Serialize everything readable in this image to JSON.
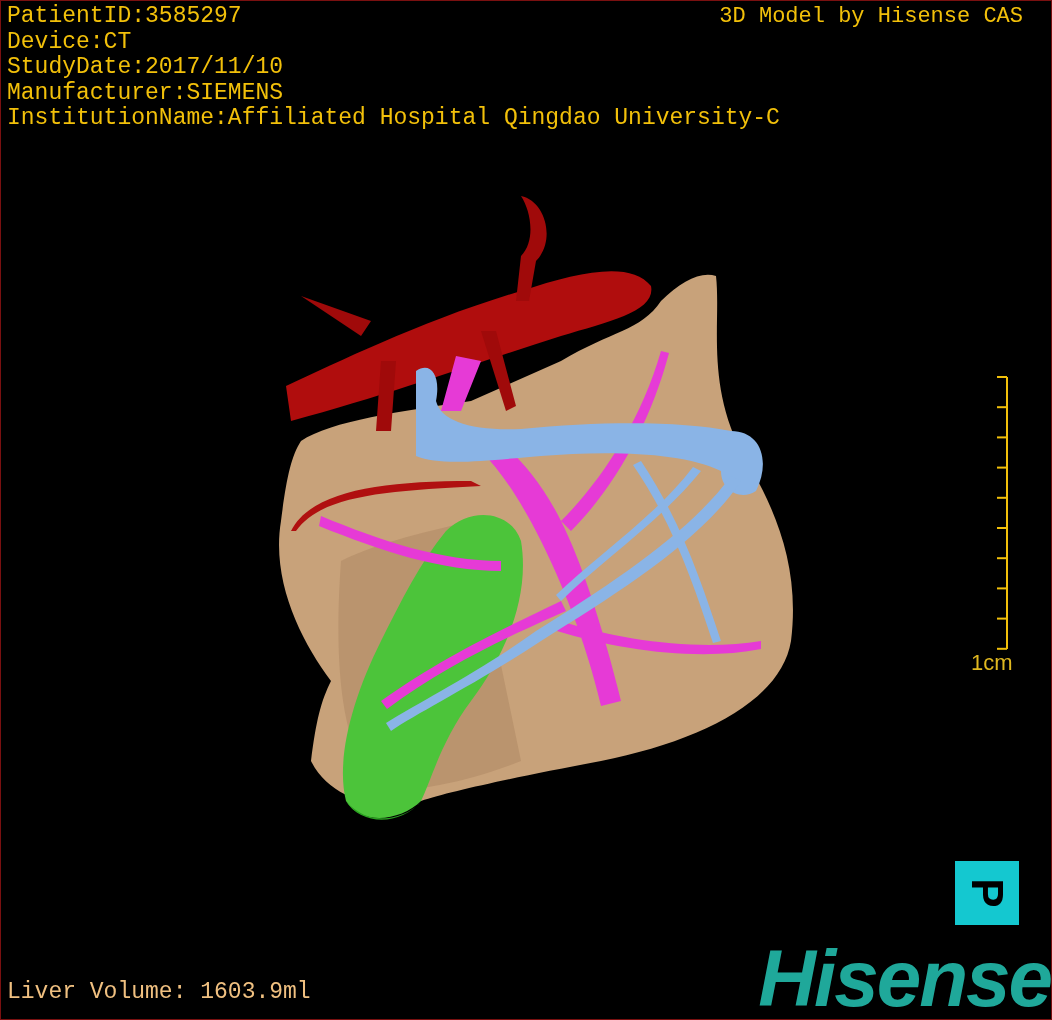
{
  "header": {
    "info_lines": [
      "PatientID:3585297",
      "Device:CT",
      "StudyDate:2017/11/10",
      "Manufacturer:SIEMENS",
      "InstitutionName:Affiliated Hospital Qingdao University-C"
    ],
    "credit": "3D Model by Hisense CAS"
  },
  "scale_bar": {
    "label": "1cm"
  },
  "orientation_marker": {
    "label": "P"
  },
  "footer": {
    "measurement": "Liver Volume: 1603.9ml"
  },
  "brand": {
    "logo_text": "Hisense"
  }
}
